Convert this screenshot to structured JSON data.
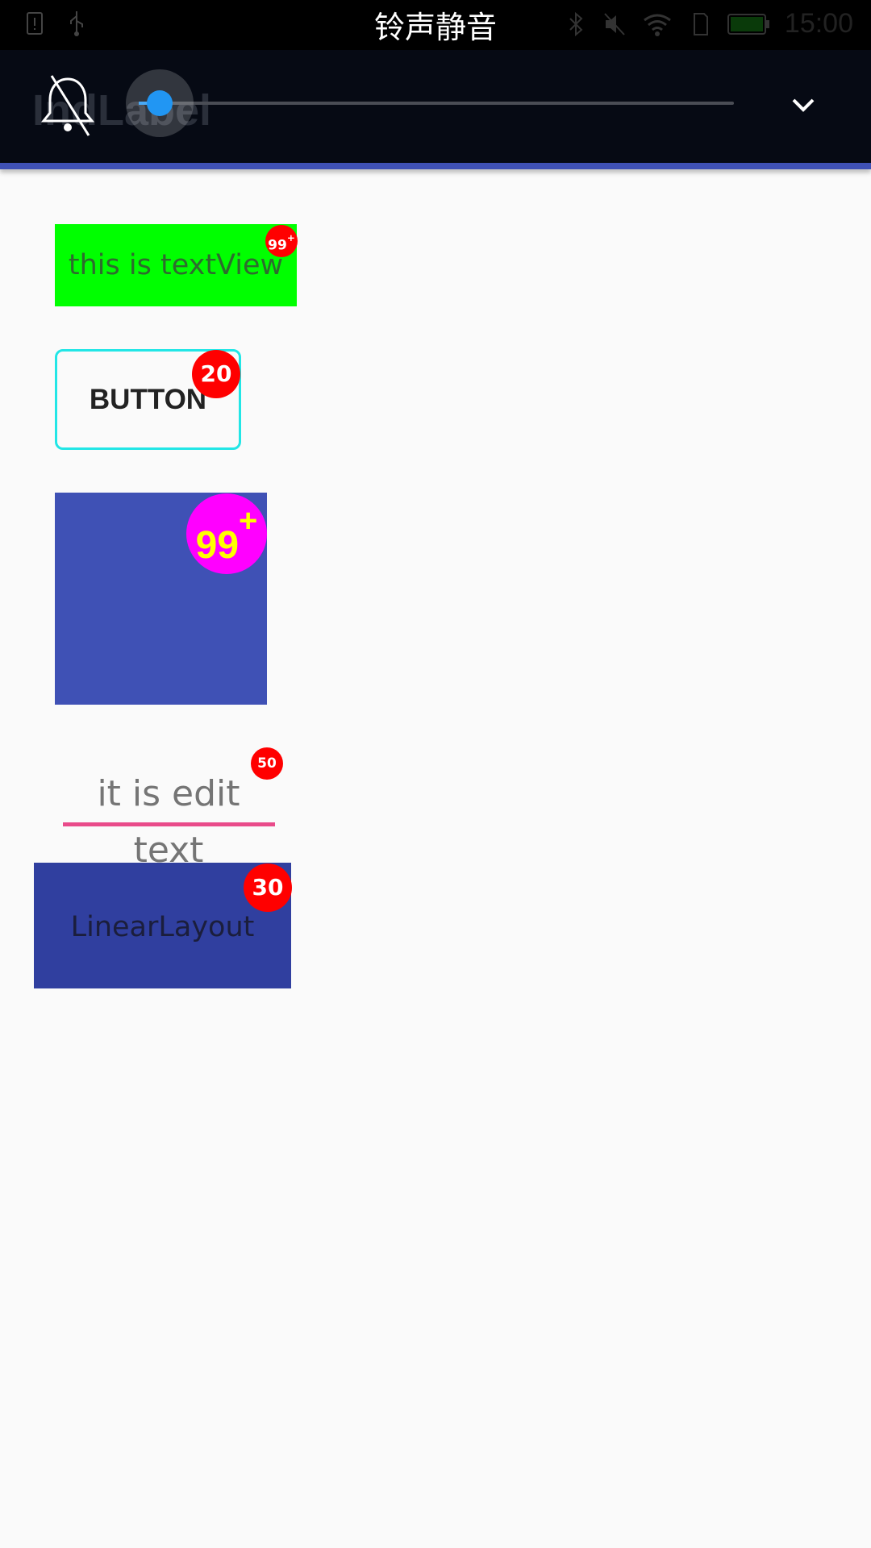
{
  "status_bar": {
    "title": "铃声静音",
    "time": "15:00",
    "left_icons": [
      "sim-alert-icon",
      "usb-icon"
    ],
    "right_icons": [
      "bluetooth-icon",
      "mute-icon",
      "wifi-icon",
      "sim-icon",
      "battery-icon"
    ]
  },
  "volume_panel": {
    "app_title_behind": "IndLabel",
    "ringer_icon": "bell-off-icon",
    "volume_level_fraction": 0.04,
    "accent_color": "#2196f3",
    "collapse_icon": "chevron-down-icon"
  },
  "content": {
    "textview": {
      "text": "this is textView",
      "badge": "99",
      "badge_plus": "+",
      "background": "#00ff00"
    },
    "button": {
      "label": "BUTTON",
      "badge": "20",
      "border_color": "#22e6e6"
    },
    "image": {
      "badge": "99",
      "badge_plus": "+",
      "background": "#3f51b5",
      "badge_color": "#ff00ff",
      "badge_text_color": "#ffff00"
    },
    "edittext": {
      "value": "it is edit text",
      "badge": "50",
      "underline_color": "#e94b8a"
    },
    "linearlayout": {
      "label": "LinearLayout",
      "badge": "30",
      "background": "#303f9f"
    },
    "badge_color": "#ff0000"
  }
}
